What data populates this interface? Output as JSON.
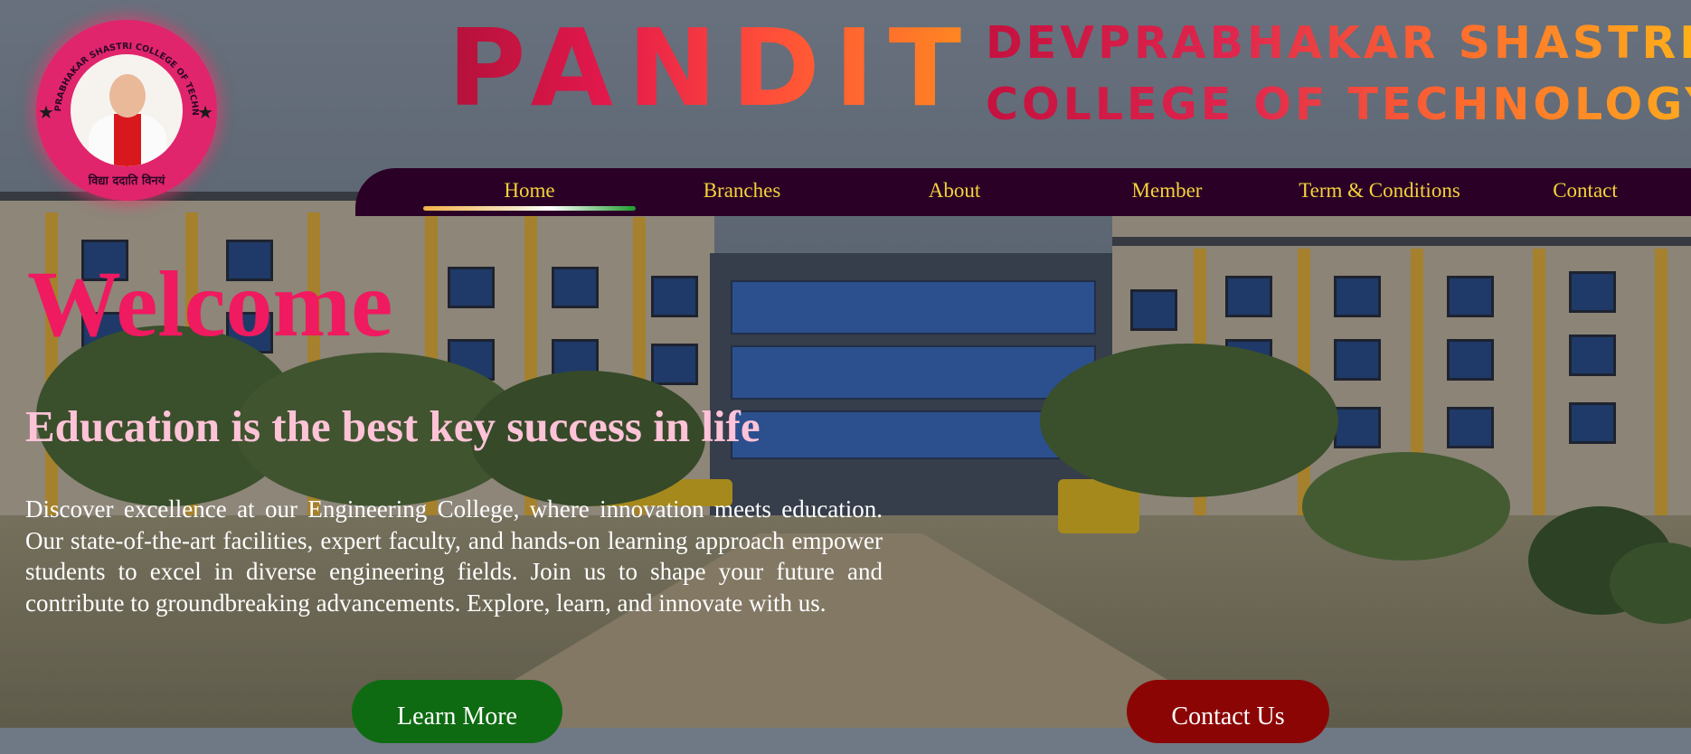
{
  "logo": {
    "ring_text": "PT. DEVPRABHAKAR SHASTRI COLLEGE OF TECHNOLOGY",
    "motto": "विद्या ददाति विनयं",
    "colors": {
      "ring": "#e0256c",
      "text": "#2a0726"
    }
  },
  "brand": {
    "word": "PANDIT",
    "line1": "DEVPRABHAKAR SHASTRI",
    "line2": "COLLEGE OF TECHNOLOGY"
  },
  "nav": {
    "items": [
      {
        "label": "Home",
        "active": true
      },
      {
        "label": "Branches"
      },
      {
        "label": "About"
      },
      {
        "label": "Member"
      },
      {
        "label": "Term & Conditions"
      },
      {
        "label": "Contact"
      }
    ],
    "colors": {
      "background": "#2a0026",
      "text": "#f5d23c"
    }
  },
  "hero": {
    "title": "Welcome",
    "subtitle": "Education is the best key success in life",
    "description": "Discover excellence at our Engineering College, where innovation meets education. Our state-of-the-art facilities, expert faculty, and hands-on learning approach empower students to excel in diverse engineering fields. Join us to shape your future and contribute to groundbreaking advancements. Explore, learn, and innovate with us.",
    "colors": {
      "title": "#ef1a60",
      "subtitle": "#ffc3d8",
      "description": "#ffffff"
    }
  },
  "buttons": {
    "learn_more": "Learn More",
    "contact_us": "Contact Us",
    "colors": {
      "learn_more": "#0e6b12",
      "contact_us": "#8c0505"
    }
  }
}
